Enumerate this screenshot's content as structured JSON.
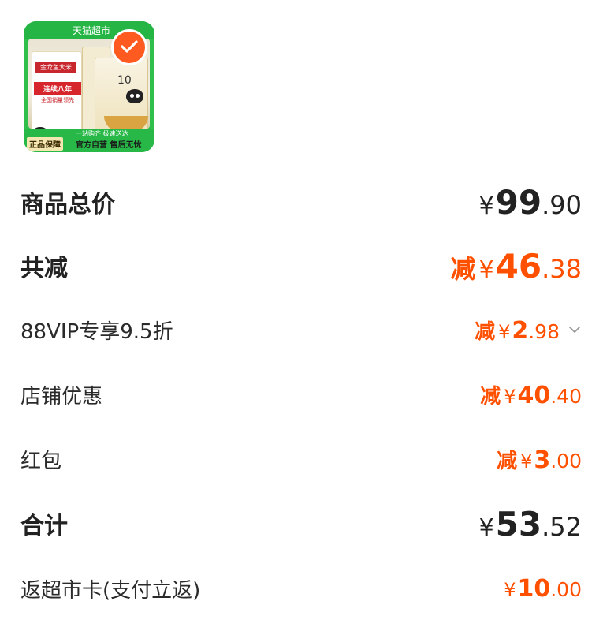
{
  "product": {
    "banner_text": "天猫超市",
    "bag_brand": "金龙鱼大米",
    "bag_slogan": "连续八年",
    "bag_sub": "全国销量领先",
    "bag_weight": "10",
    "tagline": "一站购齐 极速送达",
    "guarantee": "正品保障",
    "service": "官方自营 售后无忧",
    "selected": true
  },
  "rows": [
    {
      "label": "商品总价",
      "prefix": "",
      "currency": "¥",
      "integer": "99",
      "decimal": ".90"
    },
    {
      "label": "共减",
      "prefix": "减",
      "currency": "¥",
      "integer": "46",
      "decimal": ".38"
    },
    {
      "label": "88VIP专享9.5折",
      "prefix": "减",
      "currency": "¥",
      "integer": "2",
      "decimal": ".98",
      "expandable": true
    },
    {
      "label": "店铺优惠",
      "prefix": "减",
      "currency": "¥",
      "integer": "40",
      "decimal": ".40"
    },
    {
      "label": "红包",
      "prefix": "减",
      "currency": "¥",
      "integer": "3",
      "decimal": ".00"
    },
    {
      "label": "合计",
      "prefix": "",
      "currency": "¥",
      "integer": "53",
      "decimal": ".52"
    },
    {
      "label": "返超市卡(支付立返)",
      "prefix": "",
      "currency": "¥",
      "integer": "10",
      "decimal": ".00"
    }
  ],
  "colors": {
    "discount": "#ff5000",
    "text": "#222222",
    "badge": "#ff5a1f",
    "chevron": "#999999"
  },
  "icons": {
    "check": "check-icon",
    "chevron": "chevron-down-icon"
  }
}
